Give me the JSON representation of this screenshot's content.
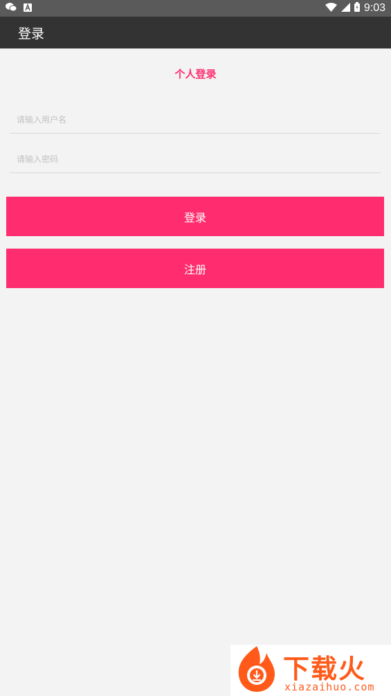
{
  "status_bar": {
    "time": "9:03",
    "left_icons": [
      "wechat-icon",
      "font-a-icon"
    ],
    "right_icons": [
      "wifi-icon",
      "signal-icon",
      "battery-icon"
    ]
  },
  "app_bar": {
    "title": "登录"
  },
  "login": {
    "heading": "个人登录",
    "username_placeholder": "请输入用户名",
    "username_value": "",
    "password_placeholder": "请输入密码",
    "password_value": "",
    "login_label": "登录",
    "register_label": "注册"
  },
  "watermark": {
    "brand": "下载火",
    "site": "xiazaihuo.com"
  },
  "colors": {
    "accent": "#ff2d6f",
    "app_bar": "#333333",
    "status_bar": "#5a5a5a",
    "background": "#f3f3f3",
    "watermark": "#ff5a1a"
  }
}
